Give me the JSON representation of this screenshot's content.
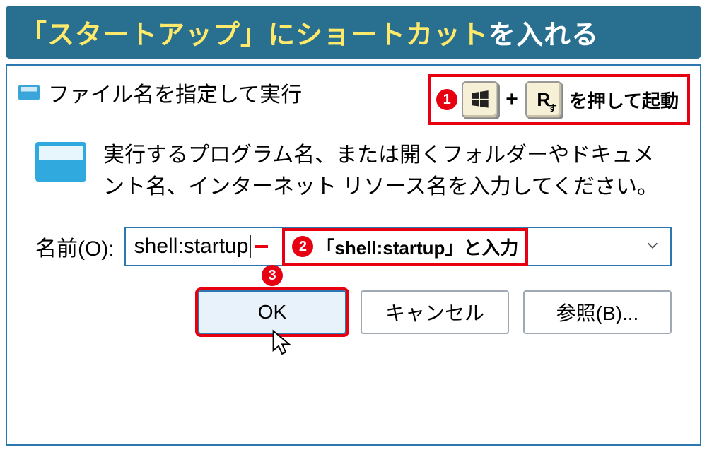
{
  "banner": {
    "part1": "「スタートアップ」にショートカット",
    "part2": "を入れる"
  },
  "dialog": {
    "title": "ファイル名を指定して実行",
    "description": "実行するプログラム名、または開くフォルダーやドキュメント名、インターネット リソース名を入力してください。",
    "input_label": "名前(O):",
    "input_value": "shell:startup",
    "buttons": {
      "ok": "OK",
      "cancel": "キャンセル",
      "browse": "参照(B)..."
    }
  },
  "annotations": {
    "step1": {
      "num": "1",
      "key2_main": "R",
      "key2_sub": "す",
      "plus": "+",
      "text": "を押して起動"
    },
    "step2": {
      "num": "2",
      "text": "「shell:startup」と入力"
    },
    "step3": {
      "num": "3"
    }
  }
}
